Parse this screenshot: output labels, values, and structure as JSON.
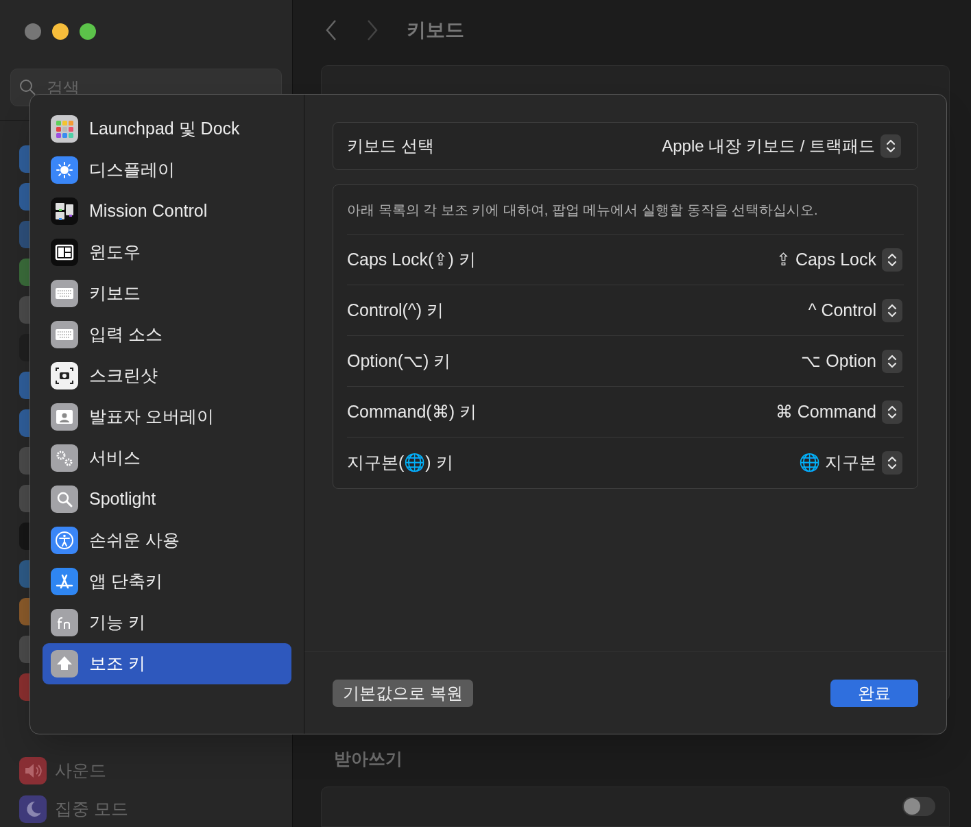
{
  "window_controls": [
    {
      "color": "#767676"
    },
    {
      "color": "#f6bd3b"
    },
    {
      "color": "#5cc34a"
    }
  ],
  "search": {
    "placeholder": "검색"
  },
  "sidebar_items": [
    {
      "label": "사운드"
    },
    {
      "label": "집중 모드"
    }
  ],
  "toolbar": {
    "title": "키보드"
  },
  "dictation": {
    "title": "받아쓰기",
    "toggle": {
      "on": false
    }
  },
  "dialog": {
    "sidebar": [
      {
        "label": "Launchpad 및 Dock",
        "selected": false
      },
      {
        "label": "디스플레이",
        "selected": false
      },
      {
        "label": "Mission Control",
        "selected": false
      },
      {
        "label": "윈도우",
        "selected": false
      },
      {
        "label": "키보드",
        "selected": false
      },
      {
        "label": "입력 소스",
        "selected": false
      },
      {
        "label": "스크린샷",
        "selected": false
      },
      {
        "label": "발표자 오버레이",
        "selected": false
      },
      {
        "label": "서비스",
        "selected": false
      },
      {
        "label": "Spotlight",
        "selected": false
      },
      {
        "label": "손쉬운 사용",
        "selected": false
      },
      {
        "label": "앱 단축키",
        "selected": false
      },
      {
        "label": "기능 키",
        "selected": false
      },
      {
        "label": "보조 키",
        "selected": true
      }
    ],
    "keyboard_select": {
      "label": "키보드 선택",
      "value": "Apple 내장 키보드 / 트랙패드"
    },
    "description": "아래 목록의 각 보조 키에 대하여, 팝업 메뉴에서 실행할 동작을 선택하십시오.",
    "modifier_rows": [
      {
        "label": "Caps Lock(⇪) 키",
        "value": "⇪ Caps Lock"
      },
      {
        "label": "Control(^) 키",
        "value": "^ Control"
      },
      {
        "label": "Option(⌥) 키",
        "value": "⌥ Option"
      },
      {
        "label": "Command(⌘) 키",
        "value": "⌘ Command"
      },
      {
        "label": "지구본(🌐) 키",
        "value": "🌐 지구본"
      }
    ],
    "buttons": [
      {
        "label": "기본값으로 복원",
        "kind": "secondary"
      },
      {
        "label": "완료",
        "kind": "primary"
      }
    ]
  }
}
